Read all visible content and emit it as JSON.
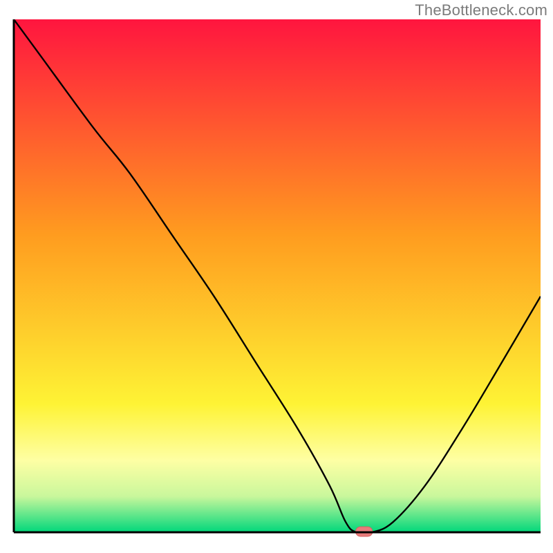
{
  "attribution": "TheBottleneck.com",
  "colors": {
    "red_top": "#ff153f",
    "orange_mid": "#ff9c1f",
    "yellow_low": "#fef335",
    "pale_yellow": "#feffa4",
    "pale_green": "#c9f79c",
    "green_bottom": "#00d77b",
    "curve": "#000000",
    "axis": "#000000",
    "marker_fill": "#e87b7b",
    "marker_stroke": "#d46060"
  },
  "chart_data": {
    "type": "line",
    "title": "",
    "xlabel": "",
    "ylabel": "",
    "xlim": [
      0,
      100
    ],
    "ylim": [
      0,
      100
    ],
    "x": [
      0,
      5,
      15,
      22,
      30,
      38,
      46,
      54,
      60,
      63,
      65,
      68,
      72,
      78,
      85,
      92,
      100
    ],
    "values": [
      100,
      93,
      79,
      70,
      58,
      46,
      33,
      20,
      9,
      2,
      0,
      0,
      2,
      9,
      20,
      32,
      46
    ],
    "optimal_marker": {
      "x_center": 66.5,
      "width": 3.2
    },
    "notes": "V-shaped bottleneck curve: sharp drop from left, flat minimum near x≈66, moderate rise toward right."
  }
}
